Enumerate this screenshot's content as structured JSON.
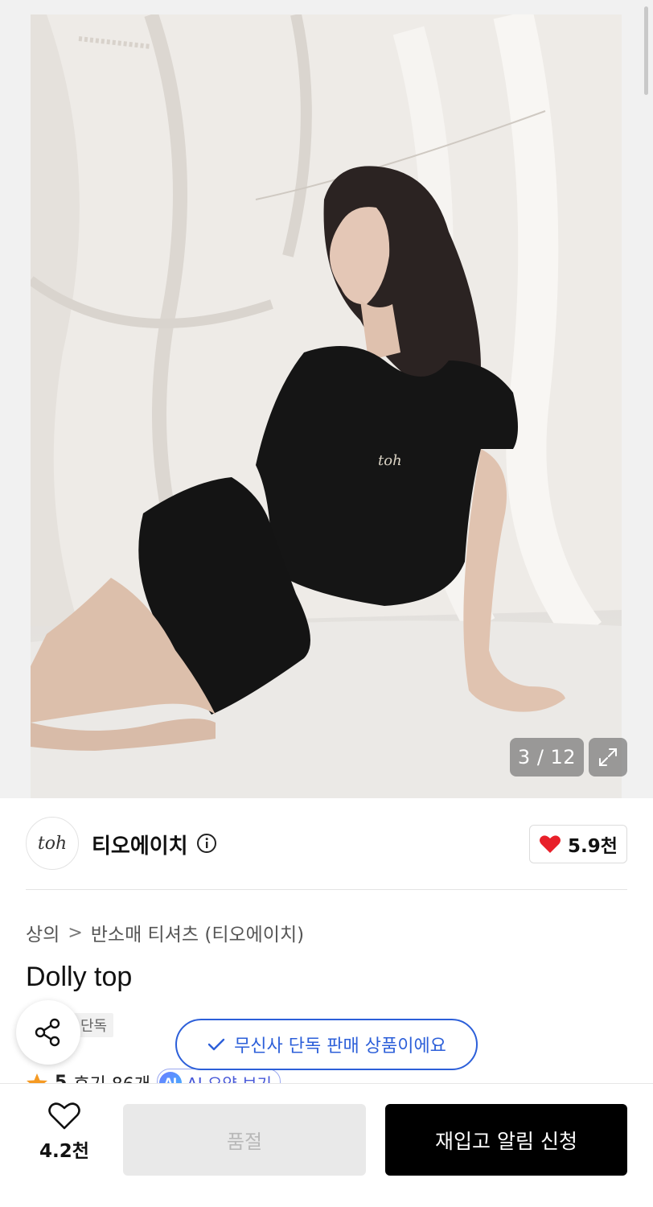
{
  "gallery": {
    "counter": "3 / 12",
    "photo_logo_text": "toh",
    "icons": {
      "expand": "expand-icon"
    }
  },
  "brand": {
    "logo_text": "toh",
    "name": "티오에이치",
    "info_icon": "info-icon",
    "like_count": "5.9천",
    "like_icon": "heart-icon",
    "like_color": "#e8202a"
  },
  "breadcrumb": {
    "level1": "상의",
    "separator": ">",
    "level2": "반소매 티셔츠 (티오에이치)"
  },
  "product": {
    "title": "Dolly top",
    "tag": "단독"
  },
  "toast": {
    "icon": "check-icon",
    "text": "무신사 단독 판매 상품이에요",
    "color": "#2c5fd9"
  },
  "rating": {
    "score": "5",
    "reviews": "후기 86개",
    "ai_badge": "AI",
    "ai_label": "AI 요약 보기"
  },
  "bottom_bar": {
    "wish_count": "4.2천",
    "soldout_label": "품절",
    "restock_label": "재입고 알림 신청"
  }
}
